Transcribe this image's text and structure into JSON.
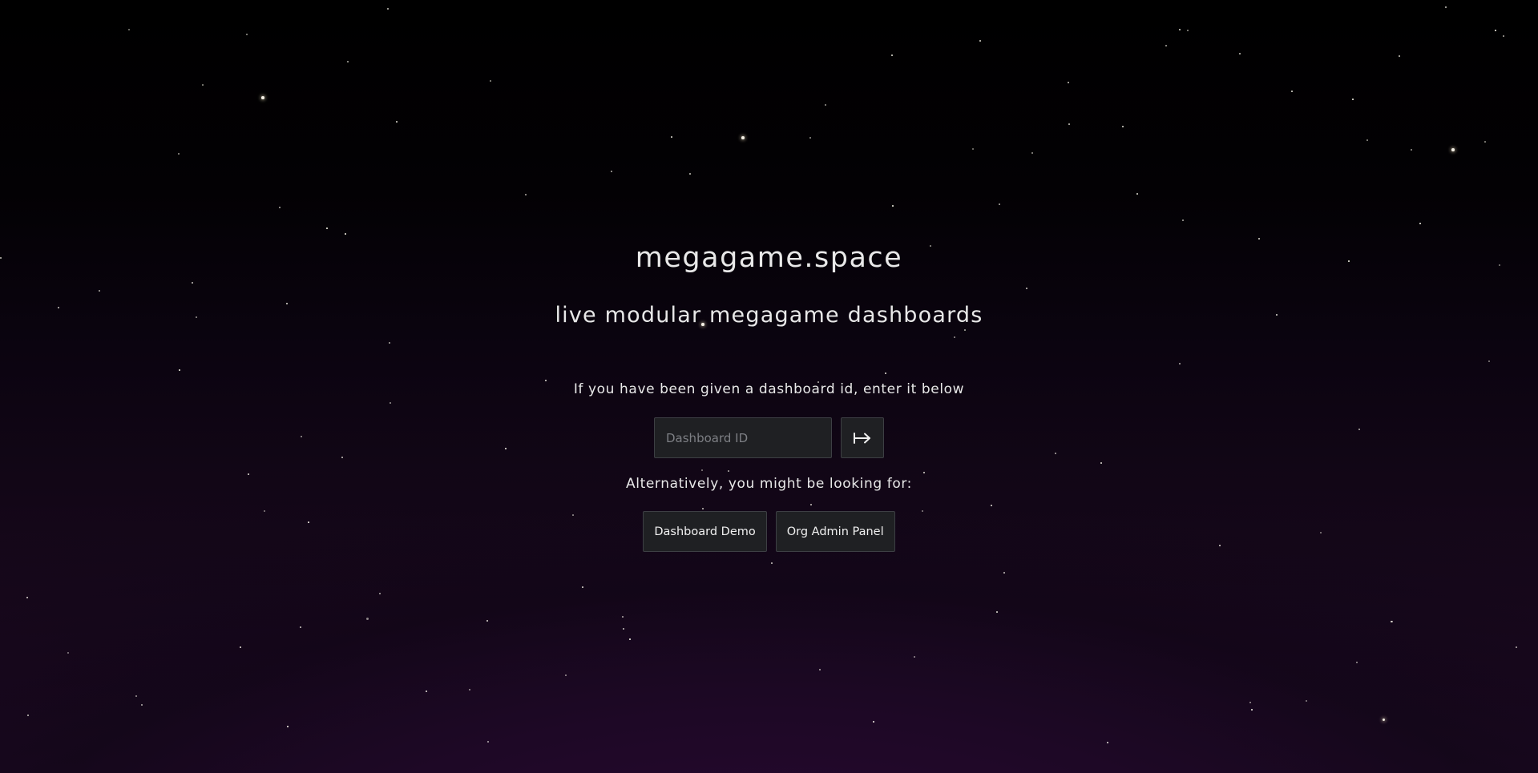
{
  "site": {
    "title": "megagame.space",
    "tagline": "live modular megagame dashboards"
  },
  "dashboard_entry": {
    "prompt": "If you have been given a dashboard id, enter it below",
    "input_placeholder": "Dashboard ID",
    "input_value": "",
    "submit_icon": "arrow-right-to-bar-icon"
  },
  "alternatives": {
    "text": "Alternatively, you might be looking for:",
    "links": [
      {
        "label": "Dashboard Demo"
      },
      {
        "label": "Org Admin Panel"
      }
    ]
  },
  "theme": {
    "background_top": "#000000",
    "background_bottom": "#1c0822",
    "control_background": "#1f2023",
    "control_border": "#3d3f44",
    "text": "#e8e8e8",
    "star": "#f4f0e6"
  }
}
